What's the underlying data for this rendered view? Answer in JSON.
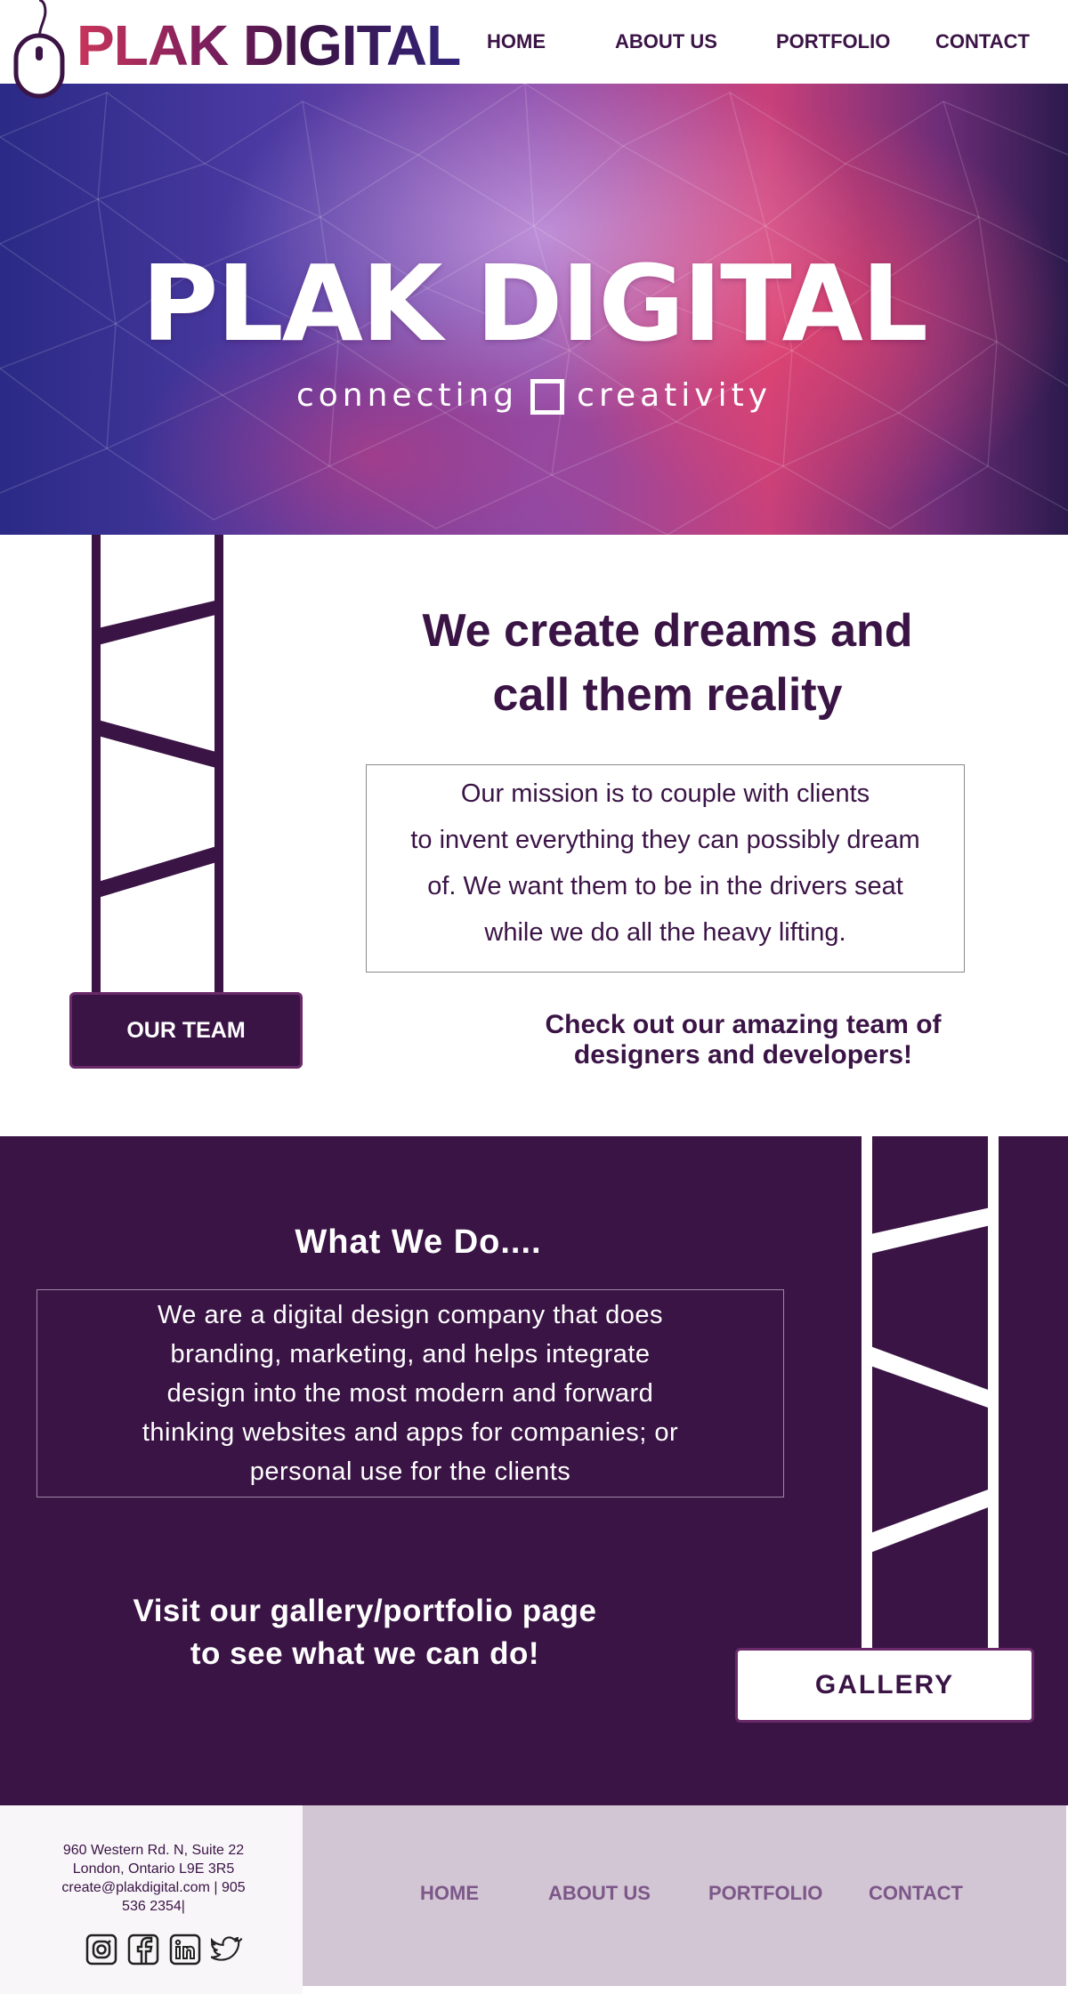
{
  "header": {
    "logo_text": "PLAK DIGITAL",
    "nav": [
      "HOME",
      "ABOUT US",
      "PORTFOLIO",
      "CONTACT"
    ]
  },
  "hero": {
    "title": "PLAK DIGITAL",
    "tagline_left": "connecting",
    "tagline_right": "creativity"
  },
  "intro": {
    "heading_line1": "We create dreams and",
    "heading_line2": "call them reality",
    "mission_lines": [
      "Our mission is to couple with clients",
      "to invent everything they can possibly dream",
      "of. We want them to be in the drivers seat",
      "while we do all the heavy lifting."
    ],
    "team_button": "OUR TEAM",
    "team_note_line1": "Check out our amazing team of",
    "team_note_line2": "designers and developers!"
  },
  "services": {
    "heading": "What We Do....",
    "body_lines": [
      "We are a digital design company that does",
      "branding, marketing, and helps integrate",
      "design into the most modern and forward",
      "thinking websites and apps for companies; or",
      "personal use for the clients"
    ],
    "gallery_note_line1": "Visit our gallery/portfolio page",
    "gallery_note_line2": "to see what we can do!",
    "gallery_button": "GALLERY"
  },
  "footer": {
    "address_lines": [
      "960 Western Rd. N, Suite 22",
      "London, Ontario L9E 3R5",
      "create@plakdigital.com | 905",
      "536 2354|"
    ],
    "social_icons": [
      "instagram-icon",
      "facebook-icon",
      "linkedin-icon",
      "twitter-icon"
    ],
    "nav": [
      "HOME",
      "ABOUT US",
      "PORTFOLIO",
      "CONTACT"
    ]
  },
  "colors": {
    "brand_purple": "#3b1446",
    "footer_panel": "#d2c5d4",
    "footer_link": "#7c5788"
  }
}
